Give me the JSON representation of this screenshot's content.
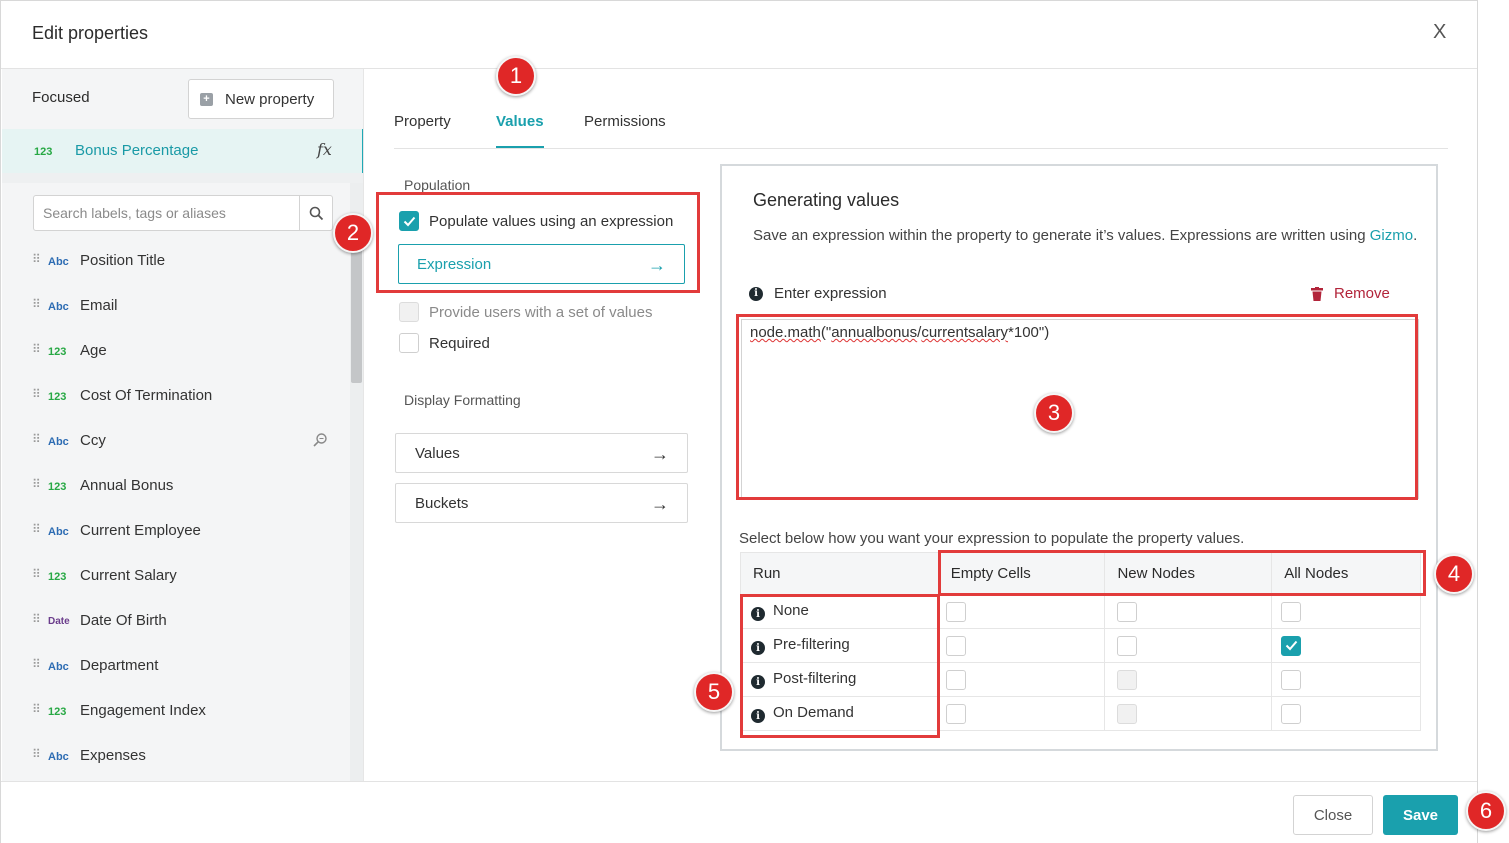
{
  "header": {
    "title": "Edit properties",
    "close_label": "X"
  },
  "sidebar": {
    "focused_label": "Focused",
    "new_property_label": "New property",
    "focused_item": {
      "type": "123",
      "label": "Bonus Percentage",
      "fx": "fx"
    },
    "search_placeholder": "Search labels, tags or aliases",
    "items": [
      {
        "type": "Abc",
        "label": "Position Title"
      },
      {
        "type": "Abc",
        "label": "Email"
      },
      {
        "type": "123",
        "label": "Age"
      },
      {
        "type": "123",
        "label": "Cost Of Termination"
      },
      {
        "type": "Abc",
        "label": "Ccy"
      },
      {
        "type": "123",
        "label": "Annual Bonus"
      },
      {
        "type": "Abc",
        "label": "Current Employee"
      },
      {
        "type": "123",
        "label": "Current Salary"
      },
      {
        "type": "Date",
        "label": "Date Of Birth"
      },
      {
        "type": "Abc",
        "label": "Department"
      },
      {
        "type": "123",
        "label": "Engagement Index"
      },
      {
        "type": "Abc",
        "label": "Expenses"
      }
    ]
  },
  "tabs": [
    {
      "label": "Property"
    },
    {
      "label": "Values"
    },
    {
      "label": "Permissions"
    }
  ],
  "population": {
    "section_label": "Population",
    "populate_expression_label": "Populate values using an expression",
    "populate_expression_checked": true,
    "expression_button": "Expression",
    "provide_set_label": "Provide users with a set of values",
    "required_label": "Required"
  },
  "display_formatting": {
    "section_label": "Display Formatting",
    "values_button": "Values",
    "buckets_button": "Buckets"
  },
  "generating": {
    "title": "Generating values",
    "description": "Save an expression within the property to generate it’s values. Expressions are written using",
    "link_text": "Gizmo",
    "link_suffix": ".",
    "enter_expression_label": "Enter expression",
    "remove_label": "Remove",
    "expression_parts": [
      "node.math",
      "(\"",
      "annualbonus",
      "/",
      "currentsalary",
      "*100\")"
    ],
    "select_description": "Select below how you want your expression to populate the property values.",
    "table": {
      "columns": [
        "Run",
        "Empty Cells",
        "New Nodes",
        "All Nodes"
      ],
      "rows": [
        {
          "label": "None",
          "empty_cells": false,
          "new_nodes": false,
          "all_nodes": false,
          "new_nodes_disabled": false
        },
        {
          "label": "Pre-filtering",
          "empty_cells": false,
          "new_nodes": false,
          "all_nodes": true,
          "new_nodes_disabled": false
        },
        {
          "label": "Post-filtering",
          "empty_cells": false,
          "new_nodes": false,
          "all_nodes": false,
          "new_nodes_disabled": true
        },
        {
          "label": "On Demand",
          "empty_cells": false,
          "new_nodes": false,
          "all_nodes": false,
          "new_nodes_disabled": true
        }
      ]
    }
  },
  "footer": {
    "close_label": "Close",
    "save_label": "Save"
  },
  "annotations": [
    "1",
    "2",
    "3",
    "4",
    "5",
    "6"
  ],
  "colors": {
    "accent": "#1aa0ad",
    "annotation": "#e02727",
    "remove": "#b2243a"
  }
}
